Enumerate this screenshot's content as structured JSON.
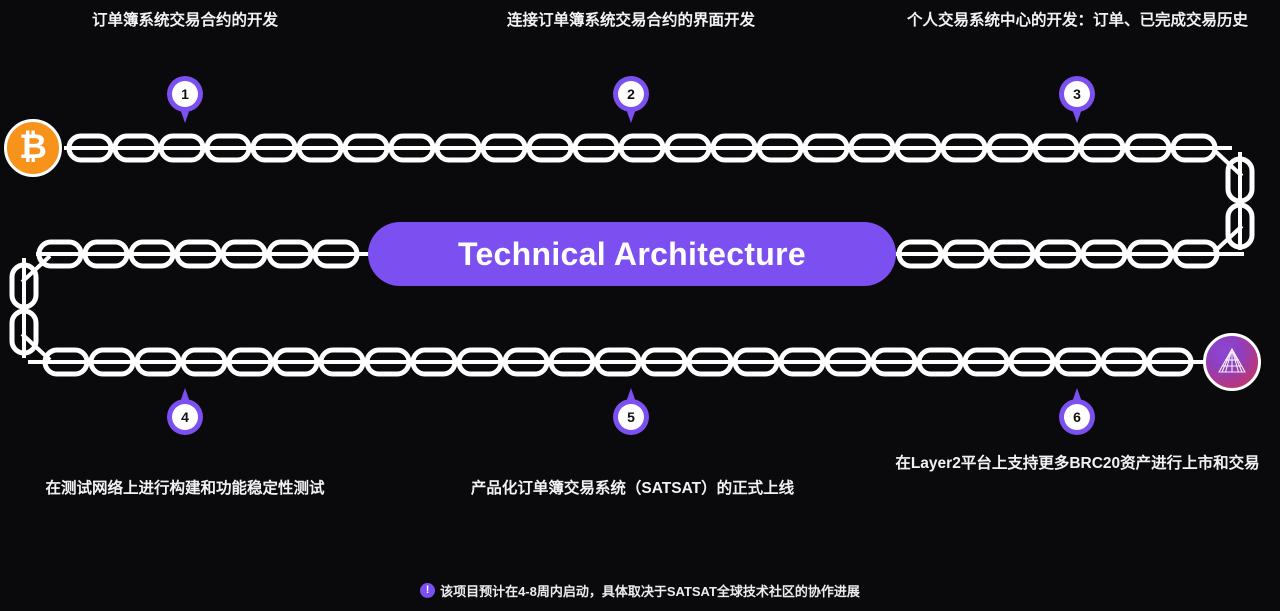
{
  "background_color": "#0a0a0c",
  "accent_color": "#7c4ff0",
  "center": {
    "title": "Technical Architecture"
  },
  "nodes": {
    "start": {
      "icon": "bitcoin-icon",
      "glyph": "₿",
      "color": "#f7931a"
    },
    "end": {
      "icon": "satsat-logo-icon",
      "color": "#b63c8e"
    }
  },
  "steps": [
    {
      "number": "1",
      "caption": "订单簿系统交易合约的开发",
      "position": "top"
    },
    {
      "number": "2",
      "caption": "连接订单簿系统交易合约的界面开发",
      "position": "top"
    },
    {
      "number": "3",
      "caption": "个人交易系统中心的开发：订单、已完成交易历史",
      "position": "top"
    },
    {
      "number": "4",
      "caption": "在测试网络上进行构建和功能稳定性测试",
      "position": "bottom"
    },
    {
      "number": "5",
      "caption": "产品化订单簿交易系统（SATSAT）的正式上线",
      "position": "bottom"
    },
    {
      "number": "6",
      "caption": "在Layer2平台上支持更多BRC20资产进行上市和交易",
      "position": "bottom"
    }
  ],
  "footer": {
    "icon": "exclamation-icon",
    "icon_glyph": "!",
    "note": "该项目预计在4-8周内启动，具体取决于SATSAT全球技术社区的协作进展"
  }
}
